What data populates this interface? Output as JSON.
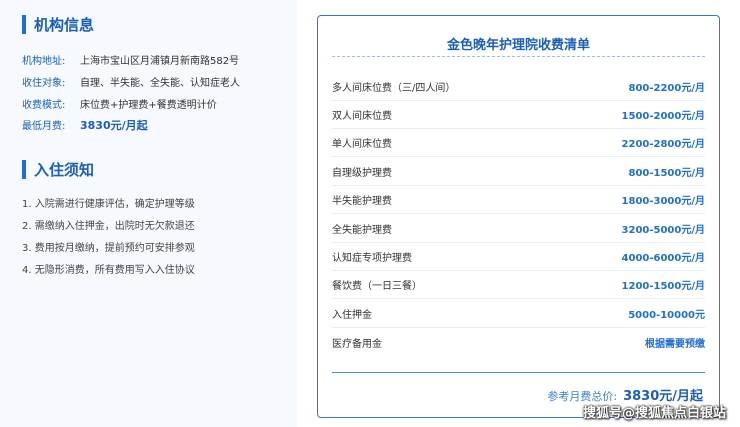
{
  "institution": {
    "title": "机构信息",
    "rows": [
      {
        "label": "机构地址:",
        "value": "上海市宝山区月浦镇月新南路582号"
      },
      {
        "label": "收住对象:",
        "value": "自理、半失能、全失能、认知症老人"
      },
      {
        "label": "收费模式:",
        "value": "床位费+护理费+餐费透明计价"
      },
      {
        "label": "最低月费:",
        "value": "3830元/月起"
      }
    ]
  },
  "admission": {
    "title": "入住须知",
    "notes": [
      "1. 入院需进行健康评估，确定护理等级",
      "2. 需缴纳入住押金，出院时无欠款退还",
      "3. 费用按月缴纳，提前预约可安排参观",
      "4. 无隐形消费，所有费用写入入住协议"
    ]
  },
  "fee_list": {
    "title": "金色晚年护理院收费清单",
    "items": [
      {
        "name": "多人间床位费（三/四人间）",
        "price": "800-2200元/月"
      },
      {
        "name": "双人间床位费",
        "price": "1500-2000元/月"
      },
      {
        "name": "单人间床位费",
        "price": "2200-2800元/月"
      },
      {
        "name": "自理级护理费",
        "price": "800-1500元/月"
      },
      {
        "name": "半失能护理费",
        "price": "1800-3000元/月"
      },
      {
        "name": "全失能护理费",
        "price": "3200-5000元/月"
      },
      {
        "name": "认知症专项护理费",
        "price": "4000-6000元/月"
      },
      {
        "name": "餐饮费（一日三餐）",
        "price": "1200-1500元/月"
      },
      {
        "name": "入住押金",
        "price": "5000-10000元"
      },
      {
        "name": "医疗备用金",
        "price": "根据需要预缴"
      }
    ],
    "total_label": "参考月费总价:",
    "total_value": "3830元/月起"
  },
  "watermark": "搜狐号@搜狐焦点白银站",
  "colors": {
    "accent": "#1c5fb8",
    "price": "#1f6fd1",
    "panel_bg": "#f6f9fd"
  }
}
